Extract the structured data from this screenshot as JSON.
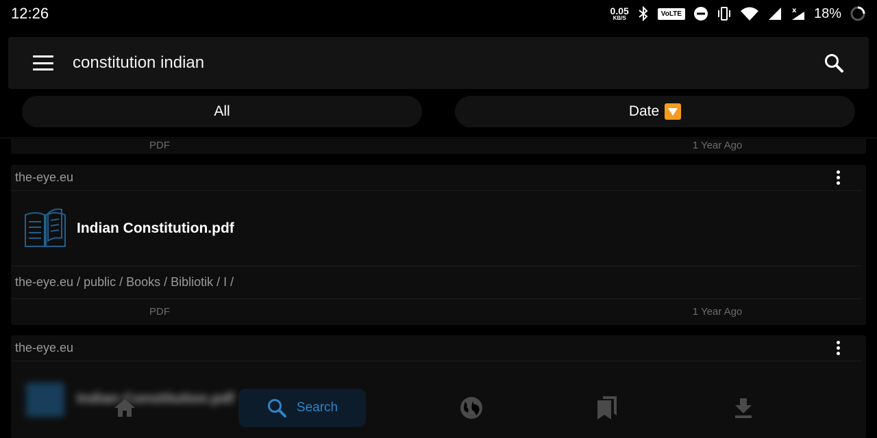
{
  "status_bar": {
    "time": "12:26",
    "net_speed_value": "0.05",
    "net_speed_unit": "KB/S",
    "volte": "VoLTE",
    "battery": "18%",
    "icons": [
      "bluetooth-icon",
      "dnd-icon",
      "vibrate-icon",
      "wifi-icon",
      "signal-icon",
      "signal-x-icon",
      "battery-ring-icon"
    ]
  },
  "search": {
    "query": "constitution indian"
  },
  "filters": {
    "all_label": "All",
    "date_label": "Date"
  },
  "results": [
    {
      "type": "PDF",
      "age": "1 Year Ago"
    },
    {
      "source": "the-eye.eu",
      "title": "Indian Constitution.pdf",
      "path": "the-eye.eu / public / Books / Bibliotik / I /",
      "type": "PDF",
      "age": "1 Year Ago"
    },
    {
      "source": "the-eye.eu",
      "title": "Indian Constitution.pdf"
    }
  ],
  "nav": {
    "search_label": "Search",
    "items": [
      "home-icon",
      "search-icon",
      "globe-icon",
      "bookmarks-icon",
      "download-icon"
    ]
  },
  "colors": {
    "accent": "#2f83c6",
    "date_badge": "#f39c1f",
    "book_icon": "#1f5f8f"
  }
}
